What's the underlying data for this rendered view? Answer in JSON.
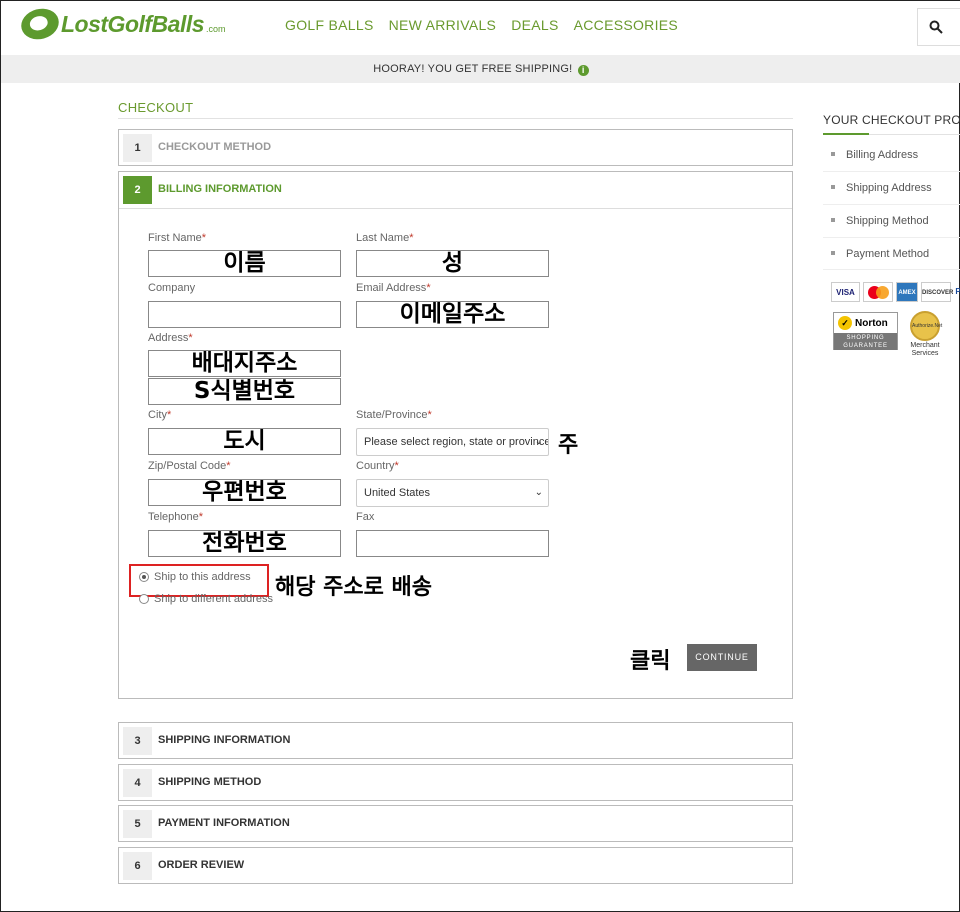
{
  "header": {
    "logo_text": "LostGolfBalls",
    "logo_suffix": ".com",
    "nav": [
      "GOLF BALLS",
      "NEW ARRIVALS",
      "DEALS",
      "ACCESSORIES"
    ]
  },
  "shipping_banner": "HOORAY! YOU GET FREE SHIPPING!",
  "checkout": {
    "title": "CHECKOUT",
    "steps": [
      {
        "num": "1",
        "label": "CHECKOUT METHOD"
      },
      {
        "num": "2",
        "label": "BILLING INFORMATION"
      },
      {
        "num": "3",
        "label": "SHIPPING INFORMATION"
      },
      {
        "num": "4",
        "label": "SHIPPING METHOD"
      },
      {
        "num": "5",
        "label": "PAYMENT INFORMATION"
      },
      {
        "num": "6",
        "label": "ORDER REVIEW"
      }
    ],
    "form": {
      "first_name_label": "First Name",
      "first_name_value": "이름",
      "last_name_label": "Last Name",
      "last_name_value": "성",
      "company_label": "Company",
      "company_value": "",
      "email_label": "Email Address",
      "email_value": "이메일주소",
      "address_label": "Address",
      "address_line1": "배대지주소",
      "address_line2": "S식별번호",
      "city_label": "City",
      "city_value": "도시",
      "state_label": "State/Province",
      "state_value": "Please select region, state or province",
      "zip_label": "Zip/Postal Code",
      "zip_value": "우편번호",
      "country_label": "Country",
      "country_value": "United States",
      "telephone_label": "Telephone",
      "telephone_value": "전화번호",
      "fax_label": "Fax",
      "fax_value": "",
      "required_mark": "*",
      "ship_same_label": "Ship to this address",
      "ship_different_label": "Ship to different address",
      "continue_label": "CONTINUE"
    },
    "annotations": {
      "state_note": "주",
      "ship_note": "해당 주소로 배송",
      "click_note": "클릭"
    }
  },
  "sidebar": {
    "title": "YOUR CHECKOUT PROGRESS",
    "items": [
      "Billing Address",
      "Shipping Address",
      "Shipping Method",
      "Payment Method"
    ],
    "cards": [
      "VISA",
      "MC",
      "AMEX",
      "DISCOVER",
      "P"
    ],
    "norton_name": "Norton",
    "norton_sub": "SHOPPING GUARANTEE",
    "authnet_seal": "Authorize.Net",
    "authnet_text": "Merchant Services"
  },
  "colors": {
    "brand_green": "#5d9a2e",
    "button_gray": "#666666",
    "highlight_red": "#dd2222"
  }
}
